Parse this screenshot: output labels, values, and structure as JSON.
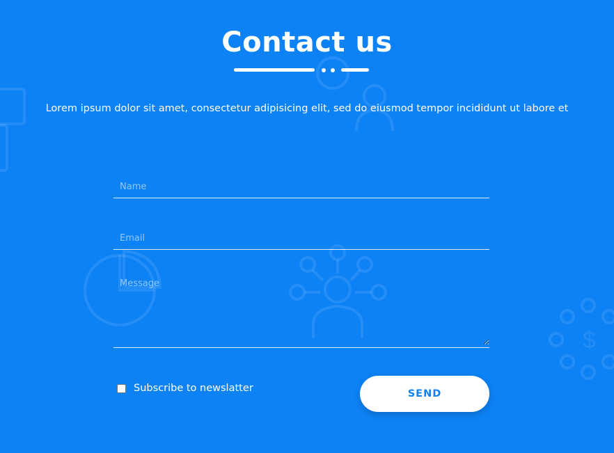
{
  "colors": {
    "background": "#0d82f5",
    "text": "#ffffff",
    "button_bg": "#ffffff",
    "button_text": "#0d82f5"
  },
  "header": {
    "title": "Contact us",
    "intro": "Lorem ipsum dolor sit amet, consectetur adipisicing elit, sed do eiusmod tempor incididunt ut labore et"
  },
  "form": {
    "name": {
      "placeholder": "Name",
      "value": ""
    },
    "email": {
      "placeholder": "Email",
      "value": ""
    },
    "message": {
      "placeholder": "Message",
      "value": ""
    },
    "subscribe_label": "Subscribe to newslatter",
    "subscribe_checked": false,
    "send_label": "SEND"
  },
  "decorations": [
    "document-icon",
    "user-icon",
    "pie-chart-icon",
    "network-user-icon",
    "dollar-network-icon"
  ]
}
